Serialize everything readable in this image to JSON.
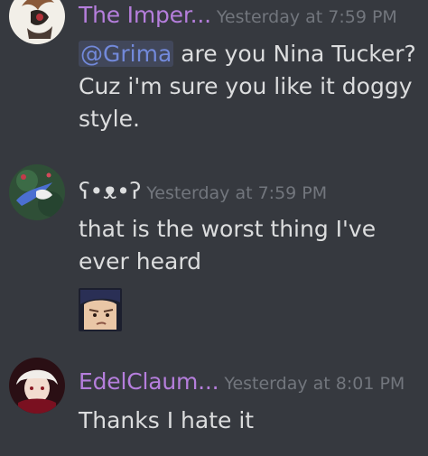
{
  "messages": [
    {
      "username": "The Imper...",
      "username_color": "#b57edc",
      "timestamp": "Yesterday at 7:59 PM",
      "mention": "@Grima",
      "text_after_mention": " are you Nina Tucker? Cuz i'm sure you like it doggy style."
    },
    {
      "username": "ʕ•ᴥ•ʔ",
      "username_color": "#dcddde",
      "timestamp": "Yesterday at 7:59 PM",
      "text": "that is the worst thing I've ever heard",
      "attachment_icon": "reaction-image-icon"
    },
    {
      "username": "EdelClaum...",
      "username_color": "#b57edc",
      "timestamp": "Yesterday at 8:01 PM",
      "text": "Thanks I hate it"
    }
  ],
  "colors": {
    "background": "#36393f",
    "text": "#dcddde",
    "timestamp": "#72767d",
    "mention": "#7289da"
  }
}
